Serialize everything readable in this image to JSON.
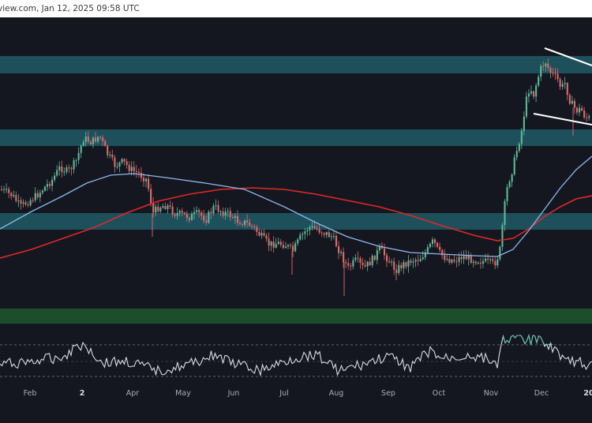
{
  "header": {
    "text": "view.com, Jan 12, 2025 09:58 UTC"
  },
  "colors": {
    "background": "#141720",
    "zone": "#1f5b66",
    "support_zone": "#1d4d2b",
    "candle_up": "#5fb89c",
    "candle_down": "#e06a6a",
    "ma_blue": "#8fb8e8",
    "ma_red": "#e02828",
    "rsi": "#d7dce8",
    "channel": "#ffffff"
  },
  "chart_data": {
    "type": "candlestick",
    "title": "",
    "xlabel": "",
    "ylabel": "",
    "x_ticks": [
      "Feb",
      "2",
      "Apr",
      "May",
      "Jun",
      "Jul",
      "Aug",
      "Sep",
      "Oct",
      "Nov",
      "Dec",
      "20"
    ],
    "grid": false,
    "zones": [
      "resistance",
      "resistance",
      "resistance",
      "support"
    ],
    "moving_averages": [
      {
        "color": "blue"
      },
      {
        "color": "red"
      }
    ],
    "indicator_panel": "RSI",
    "pattern": "descending channel (two white trendlines)"
  }
}
